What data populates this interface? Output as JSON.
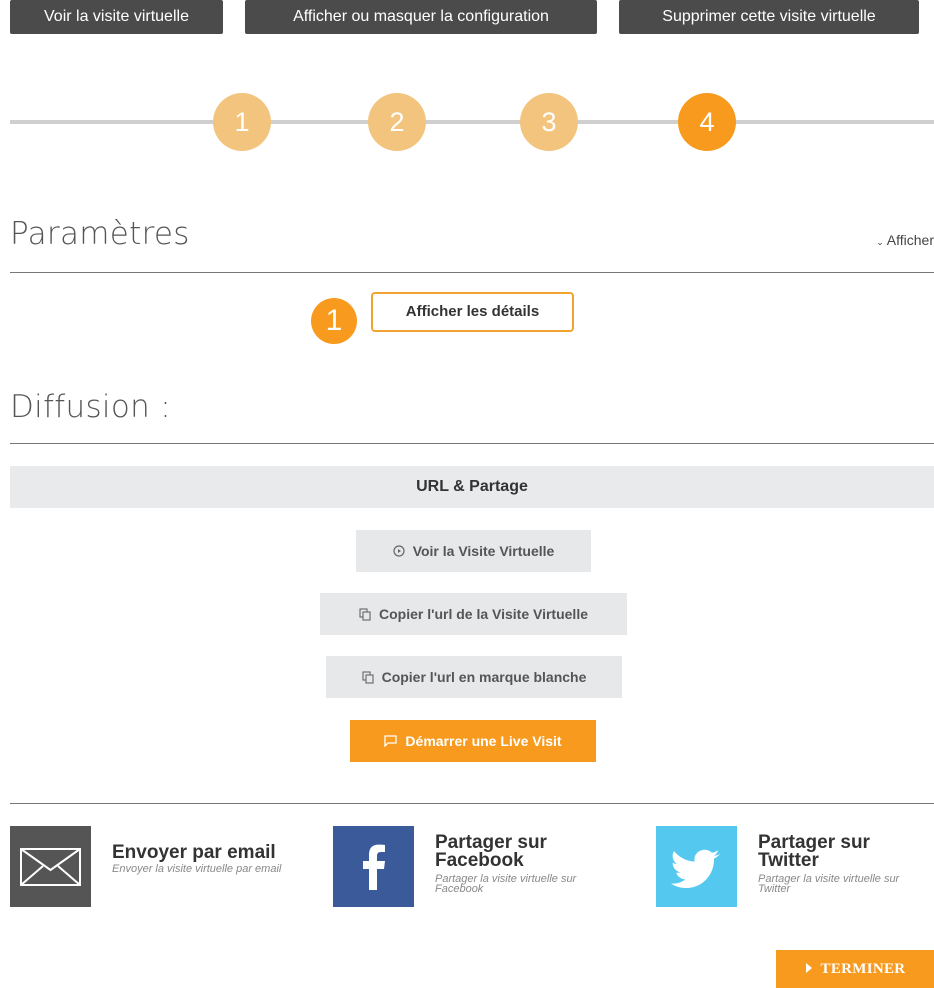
{
  "toolbar": {
    "view_label": "Voir la visite virtuelle",
    "config_label": "Afficher ou masquer la configuration",
    "delete_label": "Supprimer cette visite virtuelle"
  },
  "steps": [
    "1",
    "2",
    "3",
    "4"
  ],
  "active_step": 4,
  "parametres": {
    "title": "Paramètres",
    "toggle_label": "Afficher",
    "badge": "1",
    "details_label": "Afficher les détails"
  },
  "diffusion": {
    "title": "Diffusion :",
    "panel_title": "URL & Partage",
    "view_label": "Voir la Visite Virtuelle",
    "copy_url_label": "Copier l'url de la Visite Virtuelle",
    "copy_whitelabel_label": "Copier l'url en marque blanche",
    "live_label": "Démarrer une Live Visit"
  },
  "share": {
    "email_title": "Envoyer par email",
    "email_sub": "Envoyer la visite virtuelle par email",
    "facebook_title": "Partager sur Facebook",
    "facebook_sub": "Partager la visite virtuelle sur Facebook",
    "twitter_title": "Partager sur Twitter",
    "twitter_sub": "Partager la visite virtuelle sur Twitter"
  },
  "finish_label": "TERMINER",
  "colors": {
    "accent": "#f79a1e",
    "step_done": "#f3c47e",
    "toolbar_bg": "#4b4b4b",
    "facebook": "#3b5a9a",
    "twitter": "#55c8ef",
    "email_bg": "#555555"
  },
  "icons": {
    "email": "envelope-icon",
    "facebook": "facebook-icon",
    "twitter": "twitter-icon",
    "view": "play-circle-icon",
    "copy": "copy-icon",
    "live": "chat-icon",
    "finish": "caret-right-icon",
    "toggle": "chevron-down-icon"
  }
}
